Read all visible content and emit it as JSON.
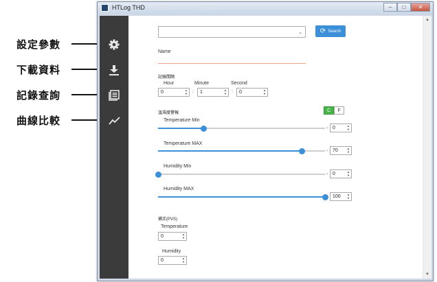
{
  "annotations": [
    {
      "label": "設定參數"
    },
    {
      "label": "下載資料"
    },
    {
      "label": "記錄查詢"
    },
    {
      "label": "曲線比較"
    }
  ],
  "window": {
    "title": "HTLog THD"
  },
  "sidebar": {
    "items": [
      {
        "icon": "gear-icon"
      },
      {
        "icon": "download-icon"
      },
      {
        "icon": "records-icon"
      },
      {
        "icon": "chart-line-icon"
      }
    ]
  },
  "main": {
    "search_button": "Search",
    "name_label": "Name",
    "interval": {
      "section": "記錄間隔",
      "hour_label": "Hour",
      "minute_label": "Minute",
      "second_label": "Second",
      "hour": "0",
      "minute": "1",
      "second": "0"
    },
    "alarm": {
      "section": "溫濕度警報",
      "unit_c": "C",
      "unit_f": "F",
      "sliders": [
        {
          "label": "Temperature Min",
          "value": "0",
          "level_pct": 27
        },
        {
          "label": "Temperature MAX",
          "value": "70",
          "level_pct": 86
        },
        {
          "label": "Humidity Min",
          "value": "0",
          "level_pct": 0
        },
        {
          "label": "Humidity MAX",
          "value": "100",
          "level_pct": 100
        }
      ]
    },
    "calibration": {
      "section": "補正(PVS)",
      "temp_label": "Temperature",
      "temp": "0",
      "hum_label": "Humidity",
      "hum": "0"
    }
  },
  "colors": {
    "sidebar": "#3b3b3b",
    "accent": "#3c8fd9",
    "toggle_on": "#48b54b",
    "name_underline": "#f0a48c"
  }
}
